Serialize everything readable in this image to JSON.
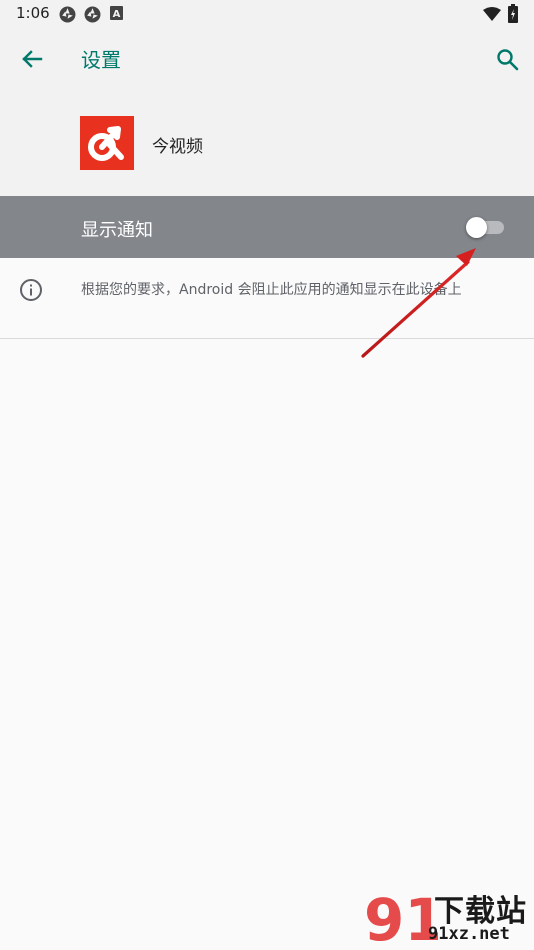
{
  "status_bar": {
    "time": "1:06",
    "icons": [
      "notification-aperture-icon",
      "notification-aperture-icon",
      "notification-a-icon",
      "wifi-icon",
      "battery-charging-icon"
    ]
  },
  "app_bar": {
    "back_icon": "arrow-left-icon",
    "title": "设置",
    "search_icon": "search-icon"
  },
  "app_header": {
    "app_name": "今视频",
    "brand_color": "#e8321f"
  },
  "notification_setting": {
    "label": "显示通知",
    "enabled": false
  },
  "info": {
    "icon": "info-icon",
    "text": "根据您的要求，Android 会阻止此应用的通知显示在此设备上"
  },
  "colors": {
    "accent": "#00796b",
    "highlight_row": "#83878c",
    "annotation_arrow": "#d61f1f"
  },
  "watermark": {
    "logo_text": "91",
    "cn_text": "下载站",
    "url_text": "91xz.net"
  }
}
